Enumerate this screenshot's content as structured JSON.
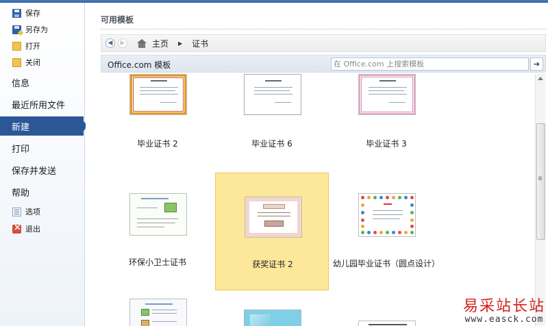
{
  "sidebar": {
    "top_items": [
      {
        "label": "保存",
        "icon": "save-icon"
      },
      {
        "label": "另存为",
        "icon": "save-as-icon"
      },
      {
        "label": "打开",
        "icon": "open-folder-icon"
      },
      {
        "label": "关闭",
        "icon": "close-folder-icon"
      }
    ],
    "main_items": [
      {
        "label": "信息"
      },
      {
        "label": "最近所用文件"
      },
      {
        "label": "新建",
        "active": true
      },
      {
        "label": "打印"
      },
      {
        "label": "保存并发送"
      },
      {
        "label": "帮助"
      }
    ],
    "bottom_items": [
      {
        "label": "选项",
        "icon": "options-icon"
      },
      {
        "label": "退出",
        "icon": "exit-icon"
      }
    ]
  },
  "main": {
    "section_title": "可用模板",
    "breadcrumb": {
      "home": "主页",
      "current": "证书"
    },
    "office_bar": {
      "label": "Office.com 模板",
      "search_placeholder": "在 Office.com 上搜索模板"
    },
    "templates": [
      {
        "label": "毕业证书 2"
      },
      {
        "label": "毕业证书 6"
      },
      {
        "label": "毕业证书 3"
      },
      {
        "label": "环保小卫士证书"
      },
      {
        "label": "获奖证书 2",
        "selected": true
      },
      {
        "label": "幼儿园毕业证书（圆点设计）"
      }
    ]
  },
  "watermark": {
    "title": "易采站长站",
    "url": "www.easck.com"
  },
  "colors": {
    "accent": "#2b5797",
    "selected_tile": "#fde89a",
    "watermark_red": "#d51f1f"
  }
}
